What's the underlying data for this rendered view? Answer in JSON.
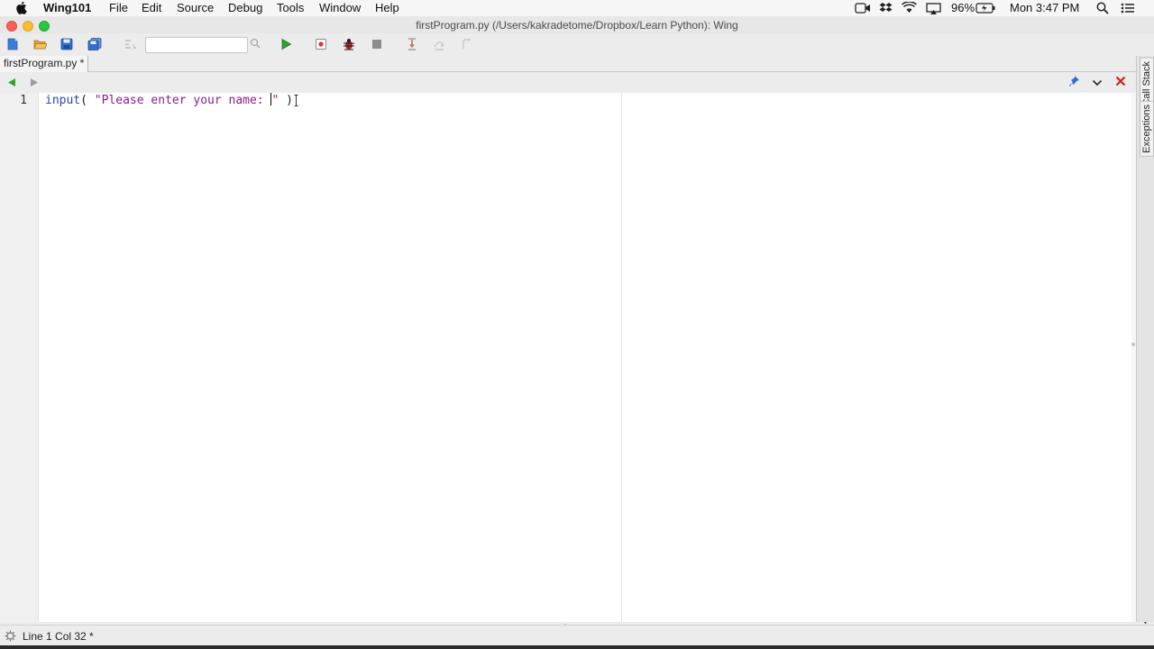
{
  "menubar": {
    "app_name": "Wing101",
    "items": [
      "File",
      "Edit",
      "Source",
      "Debug",
      "Tools",
      "Window",
      "Help"
    ],
    "battery": "96%",
    "clock": "Mon 3:47 PM"
  },
  "window": {
    "title": "firstProgram.py (/Users/kakradetome/Dropbox/Learn Python): Wing"
  },
  "toolbar": {
    "search_value": "",
    "icons": [
      "new-file-icon",
      "open-folder-icon",
      "save-icon",
      "save-all-icon",
      "indent-icon",
      "search-icon",
      "run-icon",
      "debug-stop-icon",
      "bug-icon",
      "stop-icon",
      "step-into-icon",
      "step-over-icon",
      "step-out-icon"
    ]
  },
  "editor": {
    "tab_label": "firstProgram.py *",
    "line_numbers": [
      "1"
    ],
    "code_line": {
      "func": "input",
      "open": "( ",
      "string_before_caret": "\"Please enter your name: ",
      "string_after_caret": "\"",
      "close": " )"
    }
  },
  "sidebar": {
    "tabs": [
      "Call Stack",
      "Exceptions"
    ]
  },
  "status": {
    "text": "Line 1 Col 32 *"
  },
  "colors": {
    "run_green": "#2aa52a",
    "close_red": "#cc2222",
    "keyword_blue": "#2a46a8",
    "string_purple": "#8a1f8a"
  }
}
